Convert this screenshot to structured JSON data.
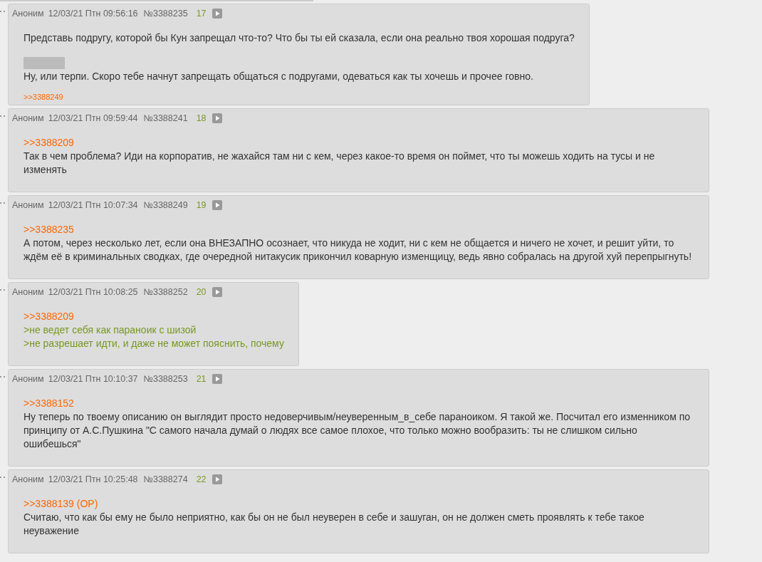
{
  "posts": [
    {
      "name": "Аноним",
      "date": "12/03/21 Птн 09:56:16",
      "number": "№3388235",
      "index": "17",
      "lines": [
        {
          "kind": "text",
          "text": "Представь подругу, которой бы Кун запрещал что-то? Что бы ты ей сказала, если она реально твоя хорошая подруга?"
        },
        {
          "kind": "spoiler"
        },
        {
          "kind": "text",
          "text": "Ну, или терпи. Скоро тебе начнут запрещать общаться с подругами, одеваться как ты хочешь и прочее говно."
        }
      ],
      "backlinks": [
        ">>3388249"
      ]
    },
    {
      "name": "Аноним",
      "date": "12/03/21 Птн 09:59:44",
      "number": "№3388241",
      "index": "18",
      "lines": [
        {
          "kind": "reply",
          "text": ">>3388209"
        },
        {
          "kind": "text",
          "text": "Так в чем проблема? Иди на корпоратив, не жахайся там ни с кем, через какое-то время он поймет, что ты можешь ходить на тусы и не изменять"
        }
      ]
    },
    {
      "name": "Аноним",
      "date": "12/03/21 Птн 10:07:34",
      "number": "№3388249",
      "index": "19",
      "lines": [
        {
          "kind": "reply",
          "text": ">>3388235"
        },
        {
          "kind": "text",
          "text": "А потом, через несколько лет, если она ВНЕЗАПНО осознает, что никуда не ходит, ни с кем не общается и ничего не хочет, и решит уйти, то ждём её в криминальных сводках, где очередной нитакусик прикончил коварную изменщицу, ведь явно собралась на другой хуй перепрыгнуть!"
        }
      ]
    },
    {
      "name": "Аноним",
      "date": "12/03/21 Птн 10:08:25",
      "number": "№3388252",
      "index": "20",
      "lines": [
        {
          "kind": "reply",
          "text": ">>3388209"
        },
        {
          "kind": "quote",
          "text": ">не ведет себя как параноик с шизой"
        },
        {
          "kind": "quote",
          "text": ">не разрешает идти, и даже не может пояснить, почему"
        }
      ]
    },
    {
      "name": "Аноним",
      "date": "12/03/21 Птн 10:10:37",
      "number": "№3388253",
      "index": "21",
      "lines": [
        {
          "kind": "reply",
          "text": ">>3388152"
        },
        {
          "kind": "text",
          "text": "Ну теперь по твоему описанию он выглядит просто недоверчивым/неуверенным_в_себе параноиком. Я такой же. Посчитал его изменником по принципу от А.С.Пушкина \"С самого начала думай о людях все самое плохое, что только можно вообразить: ты не слишком сильно ошибешься\""
        }
      ]
    },
    {
      "name": "Аноним",
      "date": "12/03/21 Птн 10:25:48",
      "number": "№3388274",
      "index": "22",
      "lines": [
        {
          "kind": "reply",
          "text": ">>3388139 (OP)"
        },
        {
          "kind": "text",
          "text": "Считаю, что как бы ему не было неприятно, как бы он не был неуверен в себе и зашуган, он не должен сметь проявлять к тебе такое неуважение"
        }
      ]
    }
  ]
}
